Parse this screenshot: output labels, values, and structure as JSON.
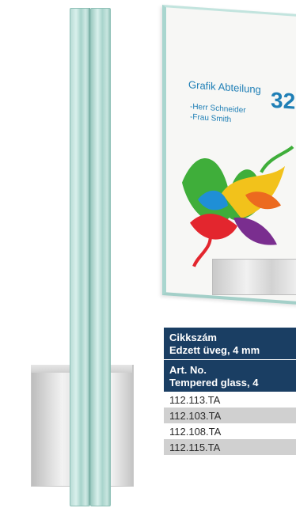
{
  "sign": {
    "title": "Grafik Abteilung",
    "number": "32",
    "names": [
      "-Herr Schneider",
      "-Frau Smith"
    ]
  },
  "table": {
    "header_hu_line1": "Cikkszám",
    "header_hu_line2": "Edzett üveg, 4 mm",
    "header_en_line1": "Art. No.",
    "header_en_line2": "Tempered glass, 4",
    "rows": [
      "112.113.TA",
      "112.103.TA",
      "112.108.TA",
      "112.115.TA"
    ]
  },
  "colors": {
    "header_bg": "#1a3e63",
    "row_shade": "#d0d0d0",
    "sign_text": "#1f7fb6",
    "glass": "#a7d3cb"
  }
}
